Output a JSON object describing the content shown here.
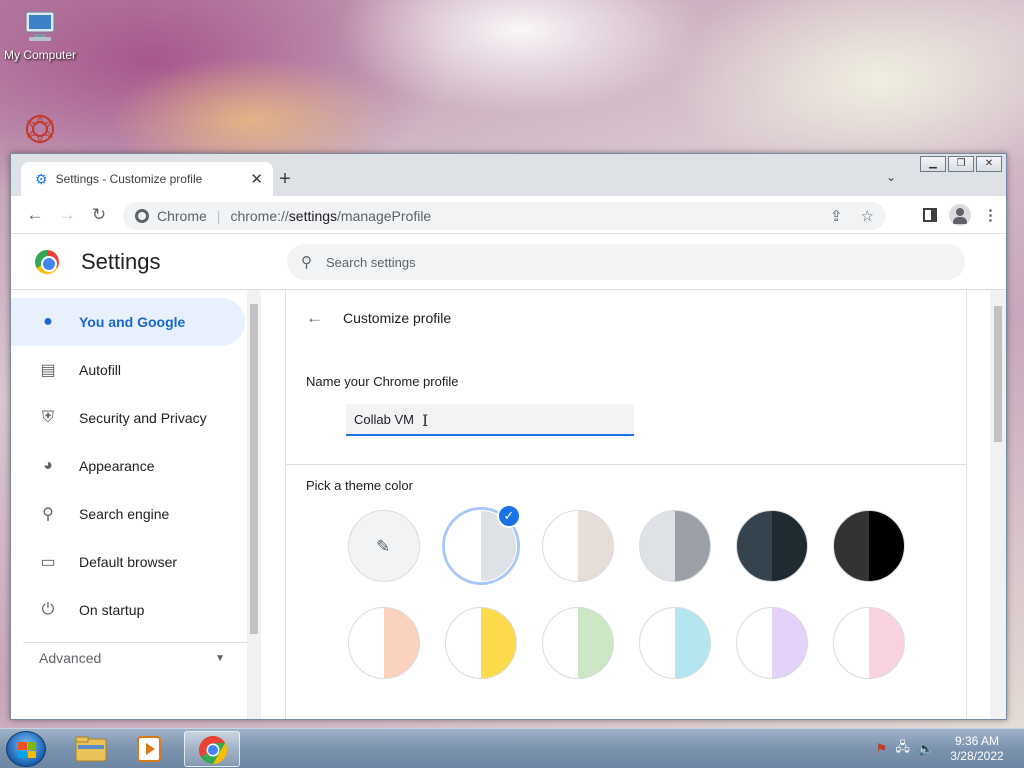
{
  "desktop": {
    "icons": [
      {
        "label": "My Computer"
      }
    ]
  },
  "browser": {
    "tab": {
      "title": "Settings - Customize profile"
    },
    "omnibox": {
      "site": "Chrome",
      "url_prefix": "chrome://",
      "url_host": "settings",
      "url_path": "/manageProfile"
    }
  },
  "settings": {
    "title": "Settings",
    "search_placeholder": "Search settings",
    "nav": [
      {
        "label": "You and Google",
        "icon": "person-icon",
        "active": true
      },
      {
        "label": "Autofill",
        "icon": "clipboard-icon"
      },
      {
        "label": "Security and Privacy",
        "icon": "shield-icon"
      },
      {
        "label": "Appearance",
        "icon": "palette-icon"
      },
      {
        "label": "Search engine",
        "icon": "search-icon"
      },
      {
        "label": "Default browser",
        "icon": "browser-icon"
      },
      {
        "label": "On startup",
        "icon": "power-icon"
      }
    ],
    "advanced_label": "Advanced",
    "page": {
      "title": "Customize profile",
      "name_label": "Name your Chrome profile",
      "name_value": "Collab VM",
      "theme_label": "Pick a theme color",
      "selected_theme_index": 1,
      "themes": [
        {
          "left": "#f1f3f4",
          "right": "#f1f3f4",
          "custom": true
        },
        {
          "left": "#ffffff",
          "right": "#dee1e6"
        },
        {
          "left": "#ffffff",
          "right": "#e6ddd9"
        },
        {
          "left": "#dee1e6",
          "right": "#9aa0a6"
        },
        {
          "left": "#35434f",
          "right": "#202a31"
        },
        {
          "left": "#333333",
          "right": "#000000"
        },
        {
          "left": "#ffffff",
          "right": "#fad2bd"
        },
        {
          "left": "#ffffff",
          "right": "#fdd94c"
        },
        {
          "left": "#ffffff",
          "right": "#cde7c4"
        },
        {
          "left": "#ffffff",
          "right": "#b3e6ef"
        },
        {
          "left": "#ffffff",
          "right": "#e4d2fb"
        },
        {
          "left": "#ffffff",
          "right": "#f8d2dc"
        }
      ]
    }
  },
  "taskbar": {
    "time": "9:36 AM",
    "date": "3/28/2022"
  },
  "colors": {
    "accent": "#1a73e8",
    "nav_active_bg": "#e8f0fe",
    "nav_active_text": "#1967d2"
  }
}
